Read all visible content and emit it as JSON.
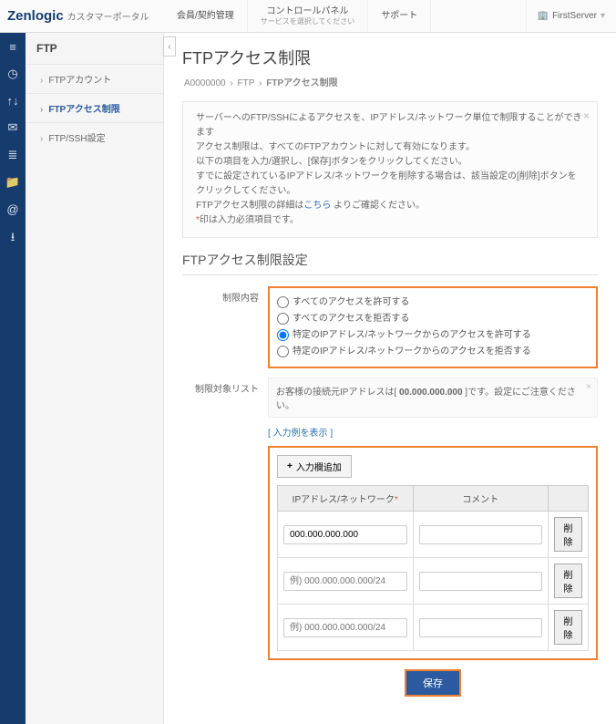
{
  "header": {
    "logo_main": "Zenlogic",
    "logo_sub": "カスタマーポータル",
    "nav": [
      {
        "label": "会員/契約管理",
        "sub": ""
      },
      {
        "label": "コントロールパネル",
        "sub": "サービスを選択してください"
      },
      {
        "label": "サポート",
        "sub": ""
      }
    ],
    "user": "FirstServer"
  },
  "rail_icons": [
    "home",
    "globe",
    "arrows",
    "envelope",
    "database",
    "folder",
    "at",
    "download"
  ],
  "sidebar": {
    "title": "FTP",
    "items": [
      {
        "label": "FTPアカウント",
        "active": false
      },
      {
        "label": "FTPアクセス制限",
        "active": true
      },
      {
        "label": "FTP/SSH設定",
        "active": false
      }
    ]
  },
  "page": {
    "title": "FTPアクセス制限",
    "breadcrumb": [
      "A0000000",
      "FTP",
      "FTPアクセス制限"
    ]
  },
  "notice": {
    "lines": [
      "サーバーへのFTP/SSHによるアクセスを、IPアドレス/ネットワーク単位で制限することができます",
      "アクセス制限は、すべてのFTPアカウントに対して有効になります。",
      "以下の項目を入力/選択し、[保存]ボタンをクリックしてください。",
      "すでに設定されているIPアドレス/ネットワークを削除する場合は、該当設定の[削除]ボタンをクリックしてください。"
    ],
    "detail_prefix": "FTPアクセス制限の詳細は",
    "detail_link": "こちら",
    "detail_suffix": "よりご確認ください。",
    "req_mark": "*",
    "req_text": "印は入力必須項目です。"
  },
  "section_title": "FTPアクセス制限設定",
  "form": {
    "restrict_label": "制限内容",
    "options": [
      "すべてのアクセスを許可する",
      "すべてのアクセスを拒否する",
      "特定のIPアドレス/ネットワークからのアクセスを許可する",
      "特定のIPアドレス/ネットワークからのアクセスを拒否する"
    ],
    "selected_index": 2,
    "list_label": "制限対象リスト",
    "client_ip_notice_pre": "お客様の接続元IPアドレスは[ ",
    "client_ip": "00.000.000.000",
    "client_ip_notice_post": " ]です。設定にご注意ください。",
    "example_link": "[ 入力例を表示 ]",
    "add_row_btn": "入力欄追加",
    "table": {
      "col_ip": "IPアドレス/ネットワーク",
      "col_comment": "コメント",
      "rows": [
        {
          "ip": "000.000.000.000",
          "placeholder": "",
          "comment": ""
        },
        {
          "ip": "",
          "placeholder": "例) 000.000.000.000/24",
          "comment": ""
        },
        {
          "ip": "",
          "placeholder": "例) 000.000.000.000/24",
          "comment": ""
        }
      ],
      "delete_label": "削除"
    },
    "save_label": "保存"
  }
}
